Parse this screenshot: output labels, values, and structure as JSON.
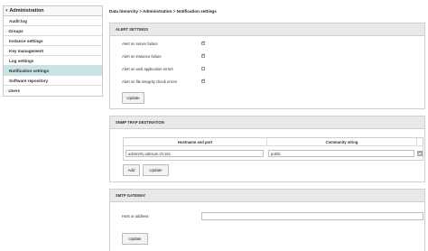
{
  "sidebar": {
    "title": "Administration",
    "items": [
      {
        "label": "Audit log",
        "chevron": false,
        "active": false,
        "indent": true
      },
      {
        "label": "Groups",
        "chevron": true,
        "active": false,
        "indent": false
      },
      {
        "label": "Instance settings",
        "chevron": false,
        "active": false,
        "indent": true
      },
      {
        "label": "Key management",
        "chevron": false,
        "active": false,
        "indent": true
      },
      {
        "label": "Log settings",
        "chevron": false,
        "active": false,
        "indent": true
      },
      {
        "label": "Notification settings",
        "chevron": false,
        "active": true,
        "indent": true
      },
      {
        "label": "Software repository",
        "chevron": false,
        "active": false,
        "indent": true
      },
      {
        "label": "Users",
        "chevron": true,
        "active": false,
        "indent": false
      }
    ]
  },
  "breadcrumb": "Data hierarchy > Administration > Notification settings",
  "alerts": {
    "title": "ALERT SETTINGS",
    "rows": [
      {
        "label": "Alert on server failure",
        "checked": true
      },
      {
        "label": "Alert on instance failure",
        "checked": true
      },
      {
        "label": "Alert on web application errors",
        "checked": false
      },
      {
        "label": "Alert on file integrity check errors",
        "checked": true
      }
    ],
    "update_label": "Update"
  },
  "snmp_trap": {
    "title": "SNMP TRAP DESTINATION",
    "columns": [
      "Hostname and port",
      "Community string"
    ],
    "rows": [
      {
        "hostname": "adnsrv01.adnsum.ch:161",
        "community": "public"
      }
    ],
    "add_label": "Add",
    "update_label": "Update"
  },
  "smtp": {
    "title": "SMTP GATEWAY",
    "host_label": "Host or address",
    "host_value": "",
    "update_label": "Update"
  },
  "icons": {
    "chevron": "chevron-down-icon",
    "check": "checkmark-icon",
    "delete": "delete-row-icon"
  }
}
